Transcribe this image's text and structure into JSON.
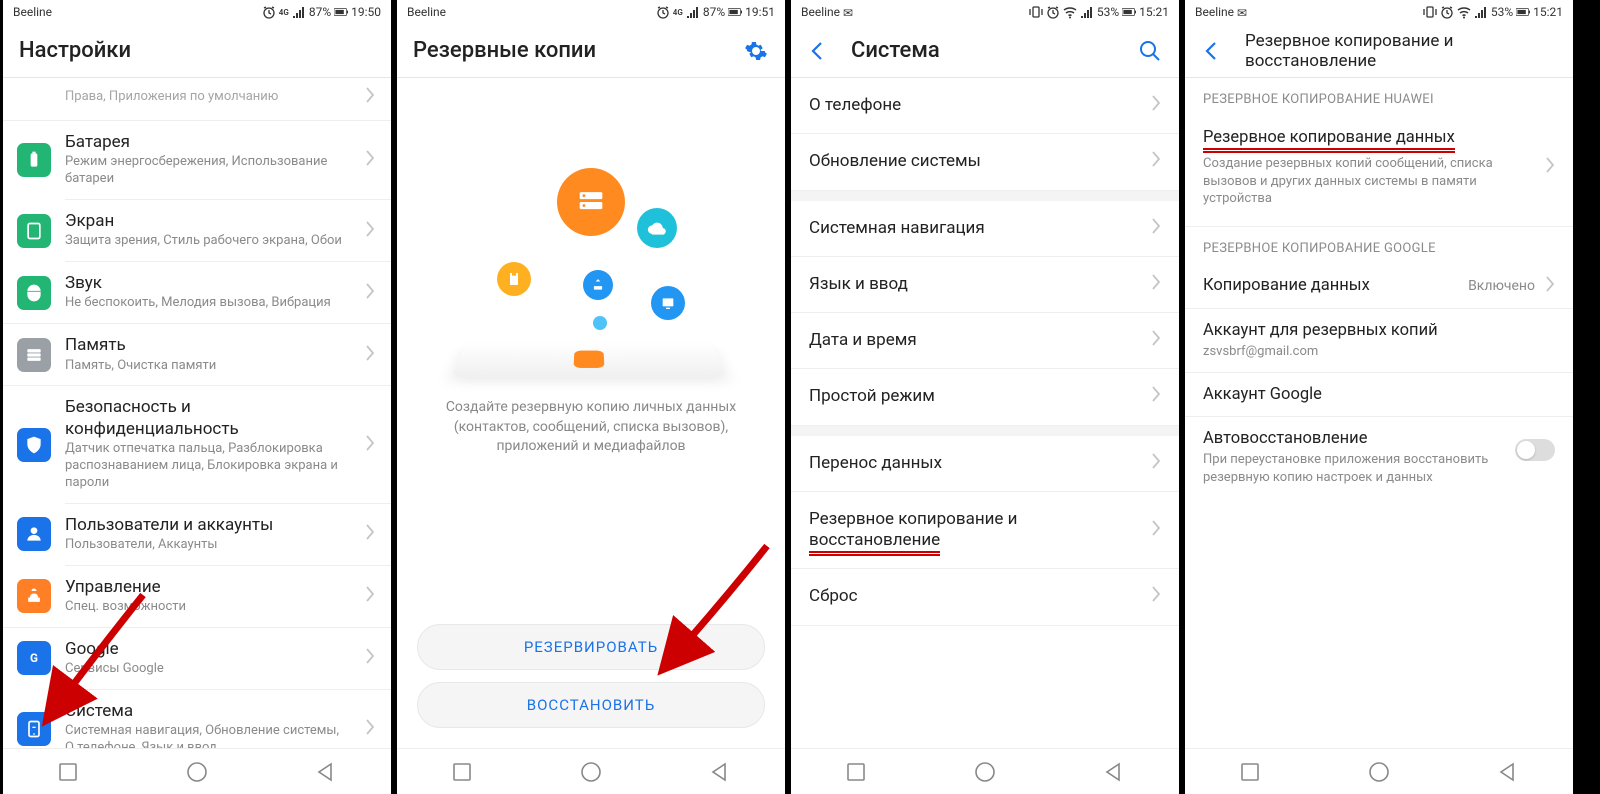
{
  "status": {
    "carrier": "Beeline",
    "battery1": "87%",
    "time1": "19:50",
    "time2": "19:51",
    "battery3": "53%",
    "time3": "15:21"
  },
  "s1": {
    "title": "Настройки",
    "row0_sub": "Права, Приложения по умолчанию",
    "rows": [
      {
        "t": "Батарея",
        "s": "Режим энергосбережения, Использование батареи",
        "c": "#22b573"
      },
      {
        "t": "Экран",
        "s": "Защита зрения, Стиль рабочего экрана, Обои",
        "c": "#22b573"
      },
      {
        "t": "Звук",
        "s": "Не беспокоить, Мелодия вызова, Вибрация",
        "c": "#22b573"
      },
      {
        "t": "Память",
        "s": "Память, Очистка памяти",
        "c": "#9aa0a6"
      },
      {
        "t": "Безопасность и конфиденциальность",
        "s": "Датчик отпечатка пальца, Разблокировка распознаванием лица, Блокировка экрана и пароли",
        "c": "#1a73e8"
      },
      {
        "t": "Пользователи и аккаунты",
        "s": "Пользователи, Аккаунты",
        "c": "#1a73e8"
      },
      {
        "t": "Управление",
        "s": "Спец. возможности",
        "c": "#ff7f27"
      },
      {
        "t": "Google",
        "s": "Сервисы Google",
        "c": "#1a73e8"
      },
      {
        "t": "Система",
        "s": "Системная навигация, Обновление системы, О телефоне, Язык и ввод",
        "c": "#1a73e8"
      }
    ]
  },
  "s2": {
    "title": "Резервные копии",
    "desc": "Создайте резервную копию личных данных (контактов, сообщений, списка вызовов), приложений и медиафайлов",
    "btn1": "РЕЗЕРВИРОВАТЬ",
    "btn2": "ВОССТАНОВИТЬ"
  },
  "s3": {
    "title": "Система",
    "rows": [
      "О телефоне",
      "Обновление системы",
      "Системная навигация",
      "Язык и ввод",
      "Дата и время",
      "Простой режим",
      "Перенос данных",
      "Резервное копирование и восстановление",
      "Сброс"
    ]
  },
  "s4": {
    "title": "Резервное копирование и восстановление",
    "sect1": "РЕЗЕРВНОЕ КОПИРОВАНИЕ HUAWEI",
    "r1t": "Резервное копирование данных",
    "r1s": "Создание резервных копий сообщений, списка вызовов и других данных системы в памяти устройства",
    "sect2": "РЕЗЕРВНОЕ КОПИРОВАНИЕ GOOGLE",
    "r2t": "Копирование данных",
    "r2v": "Включено",
    "r3t": "Аккаунт для резервных копий",
    "r3s": "zsvsbrf@gmail.com",
    "r4t": "Аккаунт Google",
    "r5t": "Автовосстановление",
    "r5s": "При переустановке приложения восстановить резервную копию настроек и данных"
  }
}
